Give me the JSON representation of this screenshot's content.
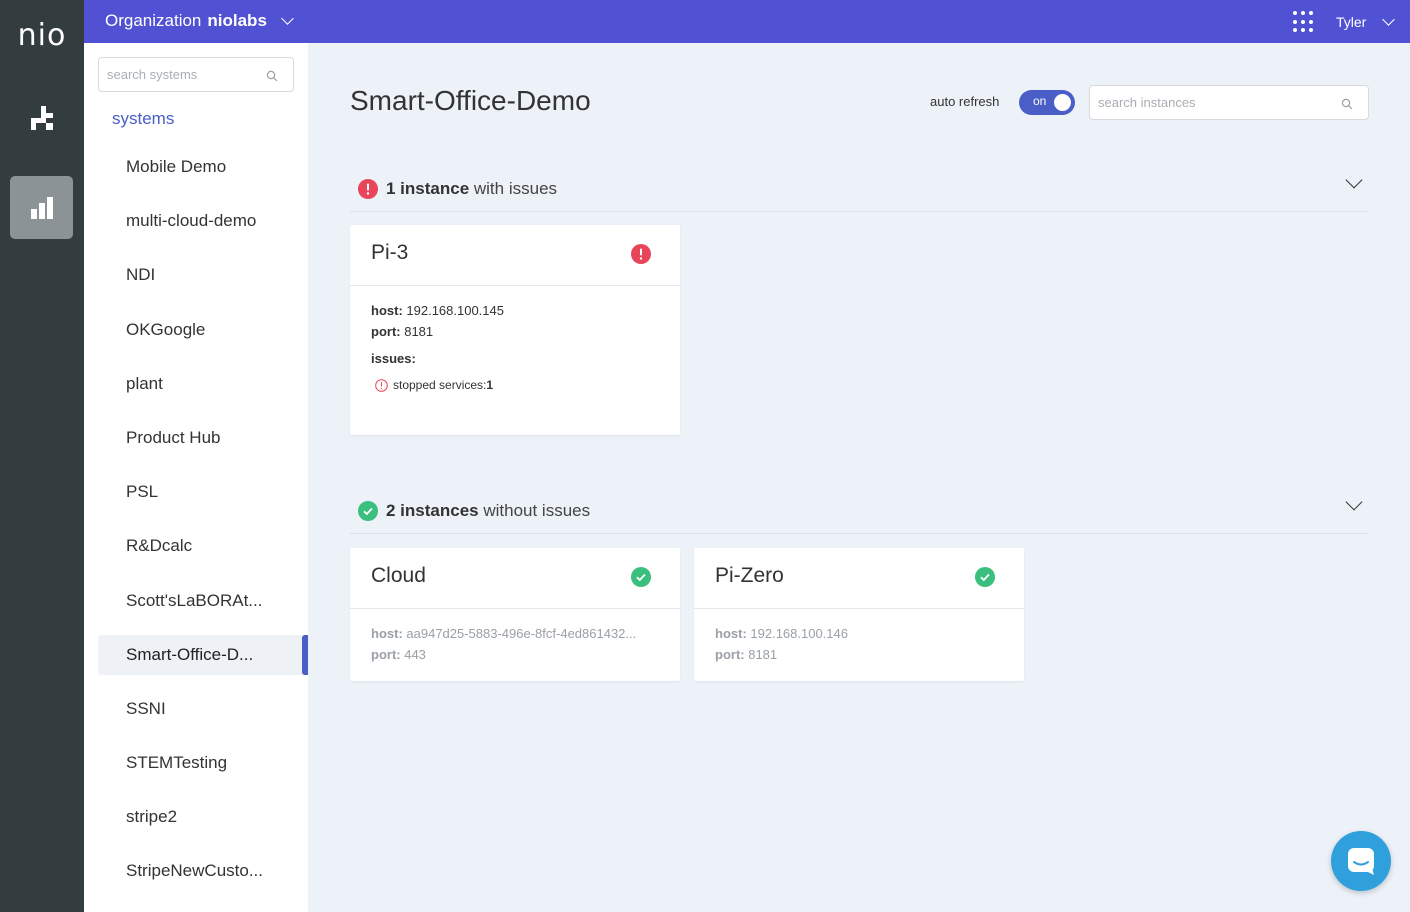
{
  "rail": {
    "logo": "nio",
    "icons": [
      "blocks-icon",
      "chart-icon"
    ]
  },
  "topbar": {
    "org_prefix": "Organization",
    "org_name": "niolabs",
    "user": "Tyler"
  },
  "sidebar": {
    "search_placeholder": "search systems",
    "title": "systems",
    "items": [
      {
        "label": "Mobile Demo"
      },
      {
        "label": "multi-cloud-demo"
      },
      {
        "label": "NDI"
      },
      {
        "label": "OKGoogle"
      },
      {
        "label": "plant"
      },
      {
        "label": "Product Hub"
      },
      {
        "label": "PSL"
      },
      {
        "label": "R&Dcalc"
      },
      {
        "label": "Scott'sLaBORAt..."
      },
      {
        "label": "Smart-Office-D...",
        "active": true
      },
      {
        "label": "SSNI"
      },
      {
        "label": "STEMTesting"
      },
      {
        "label": "stripe2"
      },
      {
        "label": "StripeNewCusto..."
      }
    ]
  },
  "main": {
    "title": "Smart-Office-Demo",
    "auto_refresh_label": "auto refresh",
    "toggle_label": "on",
    "search_placeholder": "search instances",
    "issues_group": {
      "count_text": "1 instance",
      "suffix": " with issues"
    },
    "ok_group": {
      "count_text": "2 instances",
      "suffix": " without issues"
    },
    "issue_card": {
      "title": "Pi-3",
      "host_label": "host:",
      "host": " 192.168.100.145",
      "port_label": "port:",
      "port": " 8181",
      "issues_label": "issues:",
      "issue_text": "stopped services: ",
      "issue_count": "1"
    },
    "ok_cards": [
      {
        "title": "Cloud",
        "host_label": "host:",
        "host": " aa947d25-5883-496e-8fcf-4ed861432...",
        "port_label": "port:",
        "port": " 443"
      },
      {
        "title": "Pi-Zero",
        "host_label": "host:",
        "host": " 192.168.100.146",
        "port_label": "port:",
        "port": " 8181"
      }
    ]
  },
  "colors": {
    "accent": "#4a5ec7",
    "topbar": "#5151d4",
    "error": "#e8455a",
    "success": "#3bbf7f"
  }
}
